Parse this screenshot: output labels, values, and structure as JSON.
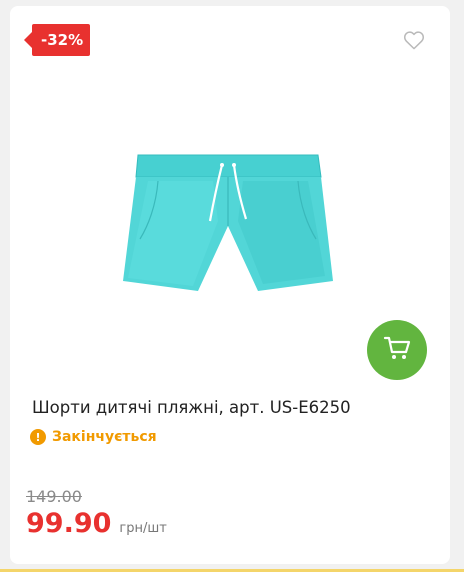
{
  "product": {
    "discount_badge": "-32%",
    "title": "Шорти дитячі пляжні, арт. US-E6250",
    "stock_status": "Закінчується",
    "old_price": "149.00",
    "new_price": "99.90",
    "unit": "грн/шт",
    "image_color": "#4fd6d6",
    "icons": {
      "favorite": "heart-icon",
      "cart": "cart-icon",
      "stock": "exclamation-icon"
    }
  },
  "colors": {
    "badge": "#e8312f",
    "cart_button": "#62b53f",
    "stock_warning": "#f19a00",
    "price": "#e8312f"
  }
}
